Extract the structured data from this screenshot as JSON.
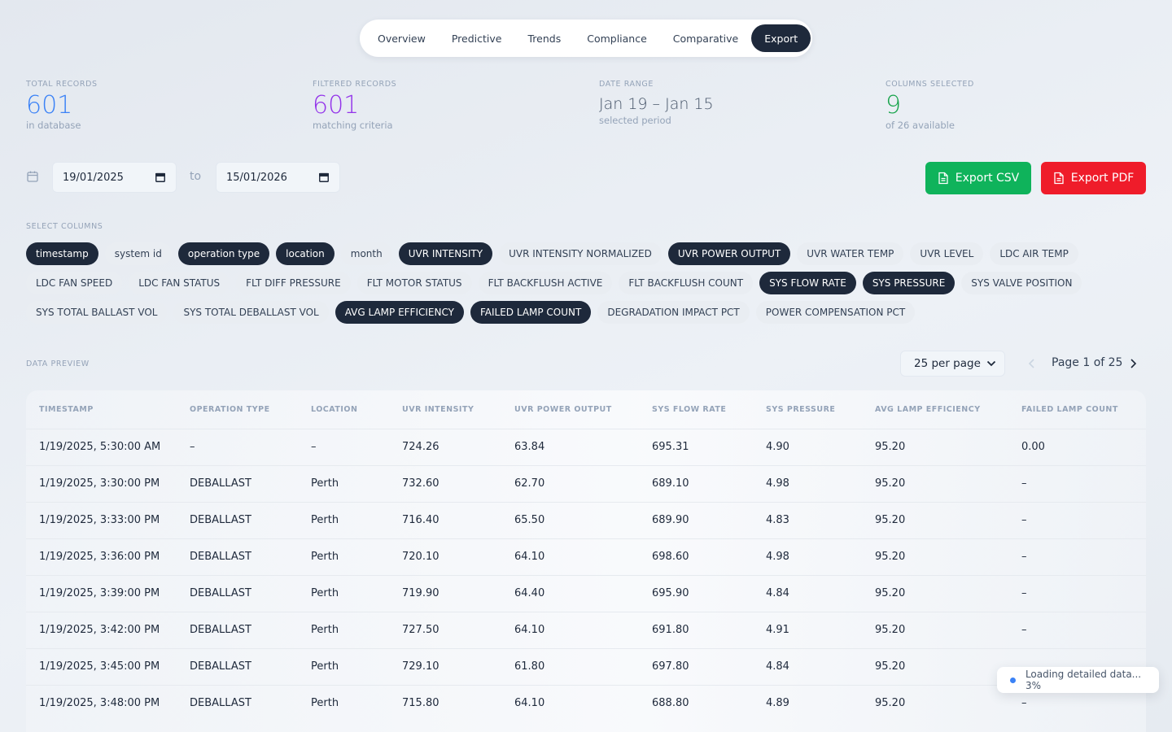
{
  "tabs": [
    {
      "label": "Overview",
      "active": false
    },
    {
      "label": "Predictive",
      "active": false
    },
    {
      "label": "Trends",
      "active": false
    },
    {
      "label": "Compliance",
      "active": false
    },
    {
      "label": "Comparative",
      "active": false
    },
    {
      "label": "Export",
      "active": true
    }
  ],
  "stats": {
    "total": {
      "label": "TOTAL RECORDS",
      "value": "601",
      "sub": "in database",
      "color": "#3b82f6"
    },
    "filtered": {
      "label": "FILTERED RECORDS",
      "value": "601",
      "sub": "matching criteria",
      "color": "#9333ea"
    },
    "range": {
      "label": "DATE RANGE",
      "value": "Jan 19 – Jan 15",
      "sub": "selected period"
    },
    "columns": {
      "label": "COLUMNS SELECTED",
      "value": "9",
      "sub": "of 26 available",
      "color": "#16a34a"
    }
  },
  "date_filter": {
    "icon": "calendar-icon",
    "from": "19/01/2025",
    "to_label": "to",
    "to": "15/01/2026"
  },
  "export": {
    "csv_label": "Export CSV",
    "pdf_label": "Export PDF",
    "csv_color": "#0fb35b",
    "pdf_color": "#ef1c2a"
  },
  "columns_section": {
    "label": "SELECT COLUMNS",
    "chips": [
      {
        "label": "timestamp",
        "selected": true
      },
      {
        "label": "system id",
        "selected": false
      },
      {
        "label": "operation type",
        "selected": true
      },
      {
        "label": "location",
        "selected": true
      },
      {
        "label": "month",
        "selected": false
      },
      {
        "label": "UVR INTENSITY",
        "selected": true
      },
      {
        "label": "UVR INTENSITY NORMALIZED",
        "selected": false
      },
      {
        "label": "UVR POWER OUTPUT",
        "selected": true
      },
      {
        "label": "UVR WATER TEMP",
        "selected": false
      },
      {
        "label": "UVR LEVEL",
        "selected": false
      },
      {
        "label": "LDC AIR TEMP",
        "selected": false
      },
      {
        "label": "LDC FAN SPEED",
        "selected": false
      },
      {
        "label": "LDC FAN STATUS",
        "selected": false
      },
      {
        "label": "FLT DIFF PRESSURE",
        "selected": false
      },
      {
        "label": "FLT MOTOR STATUS",
        "selected": false
      },
      {
        "label": "FLT BACKFLUSH ACTIVE",
        "selected": false
      },
      {
        "label": "FLT BACKFLUSH COUNT",
        "selected": false
      },
      {
        "label": "SYS FLOW RATE",
        "selected": true
      },
      {
        "label": "SYS PRESSURE",
        "selected": true
      },
      {
        "label": "SYS VALVE POSITION",
        "selected": false
      },
      {
        "label": "SYS TOTAL BALLAST VOL",
        "selected": false
      },
      {
        "label": "SYS TOTAL DEBALLAST VOL",
        "selected": false
      },
      {
        "label": "AVG LAMP EFFICIENCY",
        "selected": true
      },
      {
        "label": "FAILED LAMP COUNT",
        "selected": true
      },
      {
        "label": "DEGRADATION IMPACT PCT",
        "selected": false
      },
      {
        "label": "POWER COMPENSATION PCT",
        "selected": false
      }
    ]
  },
  "preview": {
    "label": "DATA PREVIEW",
    "per_page": "25 per page",
    "page_text": "Page 1 of 25",
    "headers": [
      "TIMESTAMP",
      "OPERATION TYPE",
      "LOCATION",
      "UVR INTENSITY",
      "UVR POWER OUTPUT",
      "SYS FLOW RATE",
      "SYS PRESSURE",
      "AVG LAMP EFFICIENCY",
      "FAILED LAMP COUNT"
    ],
    "rows": [
      [
        "1/19/2025, 5:30:00 AM",
        "–",
        "–",
        "724.26",
        "63.84",
        "695.31",
        "4.90",
        "95.20",
        "0.00"
      ],
      [
        "1/19/2025, 3:30:00 PM",
        "DEBALLAST",
        "Perth",
        "732.60",
        "62.70",
        "689.10",
        "4.98",
        "95.20",
        "–"
      ],
      [
        "1/19/2025, 3:33:00 PM",
        "DEBALLAST",
        "Perth",
        "716.40",
        "65.50",
        "689.90",
        "4.83",
        "95.20",
        "–"
      ],
      [
        "1/19/2025, 3:36:00 PM",
        "DEBALLAST",
        "Perth",
        "720.10",
        "64.10",
        "698.60",
        "4.98",
        "95.20",
        "–"
      ],
      [
        "1/19/2025, 3:39:00 PM",
        "DEBALLAST",
        "Perth",
        "719.90",
        "64.40",
        "695.90",
        "4.84",
        "95.20",
        "–"
      ],
      [
        "1/19/2025, 3:42:00 PM",
        "DEBALLAST",
        "Perth",
        "727.50",
        "64.10",
        "691.80",
        "4.91",
        "95.20",
        "–"
      ],
      [
        "1/19/2025, 3:45:00 PM",
        "DEBALLAST",
        "Perth",
        "729.10",
        "61.80",
        "697.80",
        "4.84",
        "95.20",
        ""
      ],
      [
        "1/19/2025, 3:48:00 PM",
        "DEBALLAST",
        "Perth",
        "715.80",
        "64.10",
        "688.80",
        "4.89",
        "95.20",
        "–"
      ]
    ]
  },
  "toast": {
    "text": "Loading detailed data... 3%",
    "progress": 0.03
  }
}
